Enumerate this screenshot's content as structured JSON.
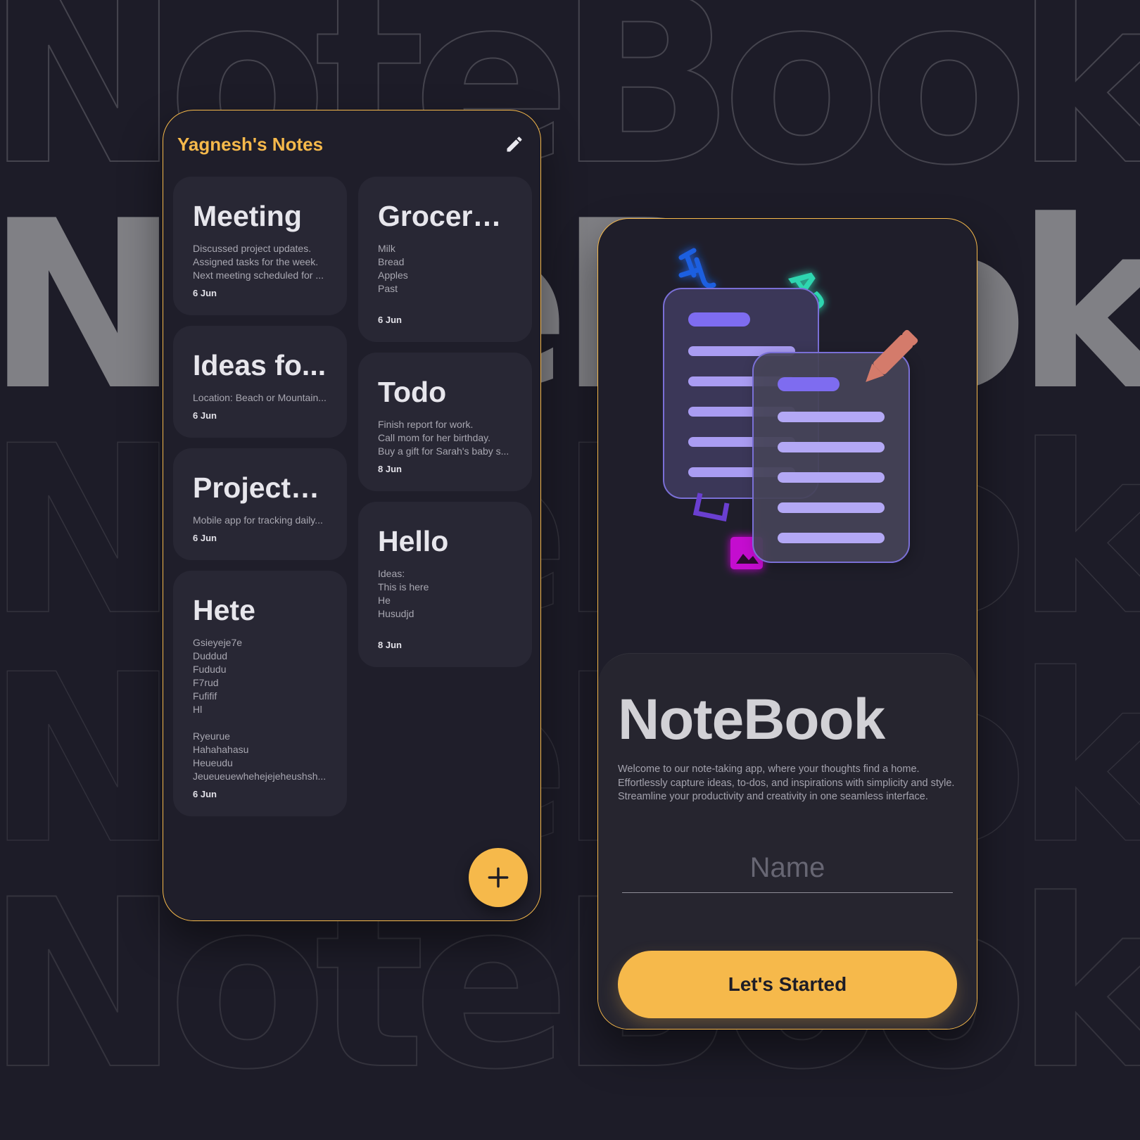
{
  "background": {
    "wordmark": "NoteBook"
  },
  "colors": {
    "accent": "#f6b94b",
    "card": "#282734",
    "screen": "#1f1e2a"
  },
  "notes_screen": {
    "title": "Yagnesh's Notes",
    "edit_icon": "pencil-icon",
    "fab_icon": "plus-icon",
    "columns": [
      [
        {
          "title": "Meeting",
          "lines": [
            "Discussed project updates.",
            "Assigned tasks for the week.",
            "Next meeting scheduled for ..."
          ],
          "date": "6 Jun"
        },
        {
          "title": "Ideas fo...",
          "lines": [
            "Location: Beach or Mountain..."
          ],
          "date": "6 Jun"
        },
        {
          "title": "Project i...",
          "lines": [
            "Mobile app for tracking daily..."
          ],
          "date": "6 Jun"
        },
        {
          "title": "Hete",
          "lines": [
            "Gsieyeje7e",
            "Duddud",
            "Fududu",
            "F7rud",
            "Fufifif",
            "Hl",
            "",
            "Ryeurue",
            "Hahahahasu",
            "Heueudu",
            "Jeueueuewhehejejeheushsh..."
          ],
          "date": "6 Jun"
        }
      ],
      [
        {
          "title": "Grocery ...",
          "lines": [
            "Milk",
            "Bread",
            "Apples",
            "Past",
            ""
          ],
          "date": "6 Jun"
        },
        {
          "title": "Todo",
          "lines": [
            "Finish report for work.",
            "Call mom for her birthday.",
            "Buy a gift for Sarah's baby s..."
          ],
          "date": "8 Jun"
        },
        {
          "title": "Hello",
          "lines": [
            "Ideas:",
            "This is here",
            "He",
            "Husudjd",
            ""
          ],
          "date": "8 Jun"
        }
      ]
    ]
  },
  "welcome_screen": {
    "illustration": "documents-illustration",
    "title": "NoteBook",
    "description": "Welcome to our note-taking app, where your thoughts find a home. Effortlessly capture ideas, to-dos, and inspirations with simplicity and style. Streamline your productivity and creativity in one seamless interface.",
    "name_placeholder": "Name",
    "name_value": "",
    "button_label": "Let's Started"
  }
}
